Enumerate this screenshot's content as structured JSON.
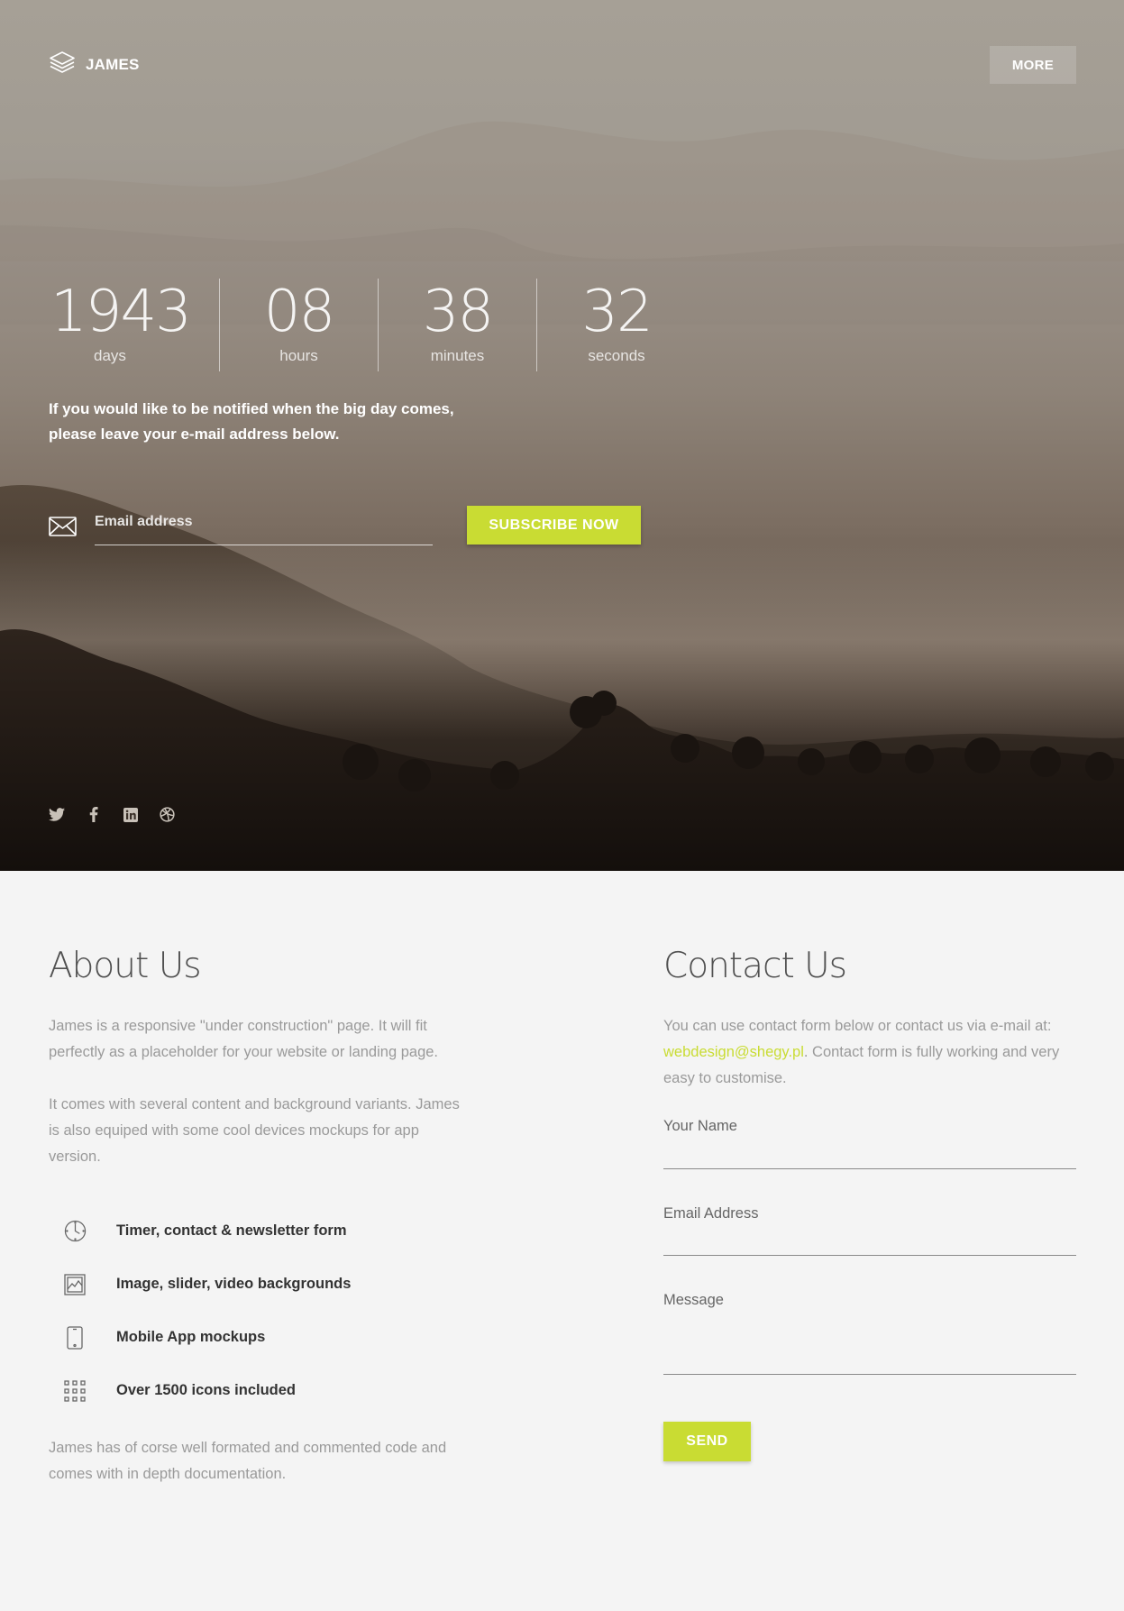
{
  "brand": {
    "name": "JAMES"
  },
  "header": {
    "more_label": "MORE"
  },
  "countdown": [
    {
      "value": "1943",
      "label": "days"
    },
    {
      "value": "08",
      "label": "hours"
    },
    {
      "value": "38",
      "label": "minutes"
    },
    {
      "value": "32",
      "label": "seconds"
    }
  ],
  "notify": {
    "text_line1": "If you would like to be notified when the big day comes,",
    "text_line2": "please leave your e-mail address below.",
    "email_placeholder": "Email address",
    "subscribe_label": "SUBSCRIBE NOW"
  },
  "socials": [
    "twitter-icon",
    "facebook-icon",
    "linkedin-icon",
    "dribbble-icon"
  ],
  "colors": {
    "accent": "#c9dc33",
    "page_bg": "#f4f4f4"
  },
  "about": {
    "title": "About Us",
    "p1": "James is a responsive \"under construction\" page. It will fit perfectly as a placeholder for your website or landing page.",
    "p2": "It comes with several content and background variants. James is also equiped with some cool devices mockups for app version.",
    "features": [
      {
        "icon": "clock-icon",
        "text": "Timer, contact & newsletter form"
      },
      {
        "icon": "image-icon",
        "text": "Image, slider, video backgrounds"
      },
      {
        "icon": "mobile-icon",
        "text": "Mobile App mockups"
      },
      {
        "icon": "grid-icon",
        "text": "Over 1500 icons included"
      }
    ],
    "p3": "James has of corse well formated and commented code and comes with in depth documentation."
  },
  "contact": {
    "title": "Contact Us",
    "intro_before": "You can use contact form below or contact us via e-mail at: ",
    "email": "webdesign@shegy.pl",
    "intro_after": ". Contact form is fully working and very easy to customise.",
    "name_label": "Your Name",
    "email_label": "Email Address",
    "message_label": "Message",
    "send_label": "SEND"
  }
}
